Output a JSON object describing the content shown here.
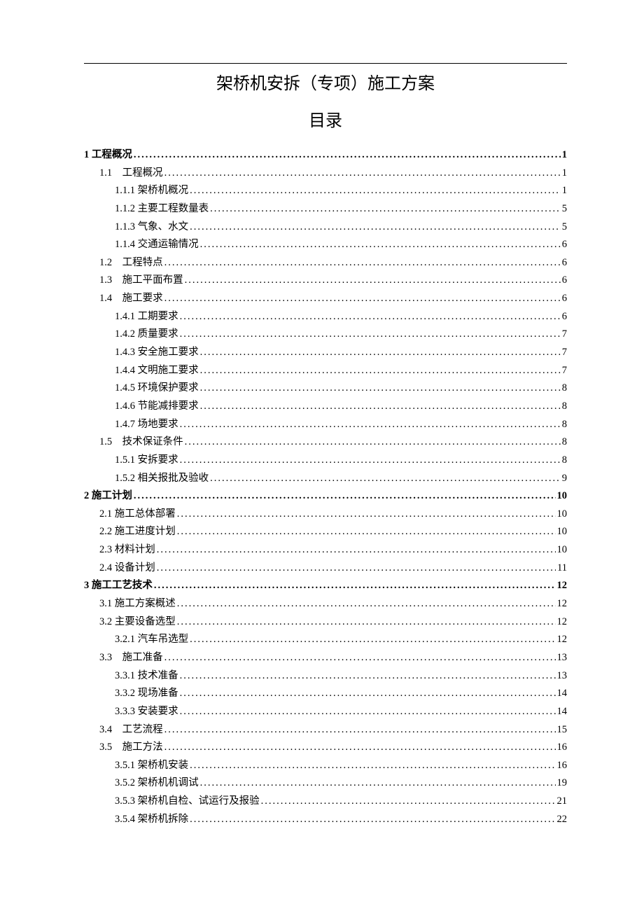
{
  "title": "架桥机安拆（专项）施工方案",
  "subtitle": "目录",
  "toc": [
    {
      "level": 0,
      "label": "1 工程概况",
      "page": "1"
    },
    {
      "level": 1,
      "label": "1.1　工程概况",
      "page": "1"
    },
    {
      "level": 2,
      "label": "1.1.1  架桥机概况",
      "page": "1"
    },
    {
      "level": 2,
      "label": "1.1.2  主要工程数量表",
      "page": "5"
    },
    {
      "level": 2,
      "label": "1.1.3  气象、水文",
      "page": "5"
    },
    {
      "level": 2,
      "label": "1.1.4  交通运输情况",
      "page": "6"
    },
    {
      "level": 1,
      "label": "1.2　工程特点",
      "page": "6"
    },
    {
      "level": 1,
      "label": "1.3　施工平面布置",
      "page": "6"
    },
    {
      "level": 1,
      "label": "1.4　施工要求",
      "page": "6"
    },
    {
      "level": 2,
      "label": "1.4.1  工期要求",
      "page": "6"
    },
    {
      "level": 2,
      "label": "1.4.2  质量要求",
      "page": "7"
    },
    {
      "level": 2,
      "label": "1.4.3  安全施工要求",
      "page": "7"
    },
    {
      "level": 2,
      "label": "1.4.4  文明施工要求",
      "page": "7"
    },
    {
      "level": 2,
      "label": "1.4.5  环境保护要求",
      "page": "8"
    },
    {
      "level": 2,
      "label": "1.4.6  节能减排要求",
      "page": "8"
    },
    {
      "level": 2,
      "label": "1.4.7  场地要求",
      "page": "8"
    },
    {
      "level": 1,
      "label": "1.5　技术保证条件",
      "page": "8"
    },
    {
      "level": 2,
      "label": "1.5.1  安拆要求",
      "page": "8"
    },
    {
      "level": 2,
      "label": "1.5.2  相关报批及验收",
      "page": "9"
    },
    {
      "level": 0,
      "label": "2 施工计划",
      "page": "10"
    },
    {
      "level": 1,
      "label": "2.1 施工总体部署",
      "page": "10"
    },
    {
      "level": 1,
      "label": "2.2 施工进度计划",
      "page": "10"
    },
    {
      "level": 1,
      "label": "2.3 材料计划",
      "page": "10"
    },
    {
      "level": 1,
      "label": "2.4 设备计划",
      "page": "11"
    },
    {
      "level": 0,
      "label": "3 施工工艺技术",
      "page": "12"
    },
    {
      "level": 1,
      "label": "3.1 施工方案概述",
      "page": "12"
    },
    {
      "level": 1,
      "label": "3.2 主要设备选型",
      "page": "12"
    },
    {
      "level": 2,
      "label": "3.2.1 汽车吊选型",
      "page": "12"
    },
    {
      "level": 1,
      "label": "3.3　施工准备",
      "page": "13"
    },
    {
      "level": 2,
      "label": "3.3.1  技术准备",
      "page": "13"
    },
    {
      "level": 2,
      "label": "3.3.2  现场准备",
      "page": "14"
    },
    {
      "level": 2,
      "label": "3.3.3  安装要求",
      "page": "14"
    },
    {
      "level": 1,
      "label": "3.4　工艺流程",
      "page": "15"
    },
    {
      "level": 1,
      "label": "3.5　施工方法",
      "page": "16"
    },
    {
      "level": 2,
      "label": "3.5.1  架桥机安装",
      "page": "16"
    },
    {
      "level": 2,
      "label": "3.5.2  架桥机机调试",
      "page": "19"
    },
    {
      "level": 2,
      "label": "3.5.3  架桥机自检、试运行及报验",
      "page": "21"
    },
    {
      "level": 2,
      "label": "3.5.4  架桥机拆除",
      "page": "22"
    }
  ]
}
